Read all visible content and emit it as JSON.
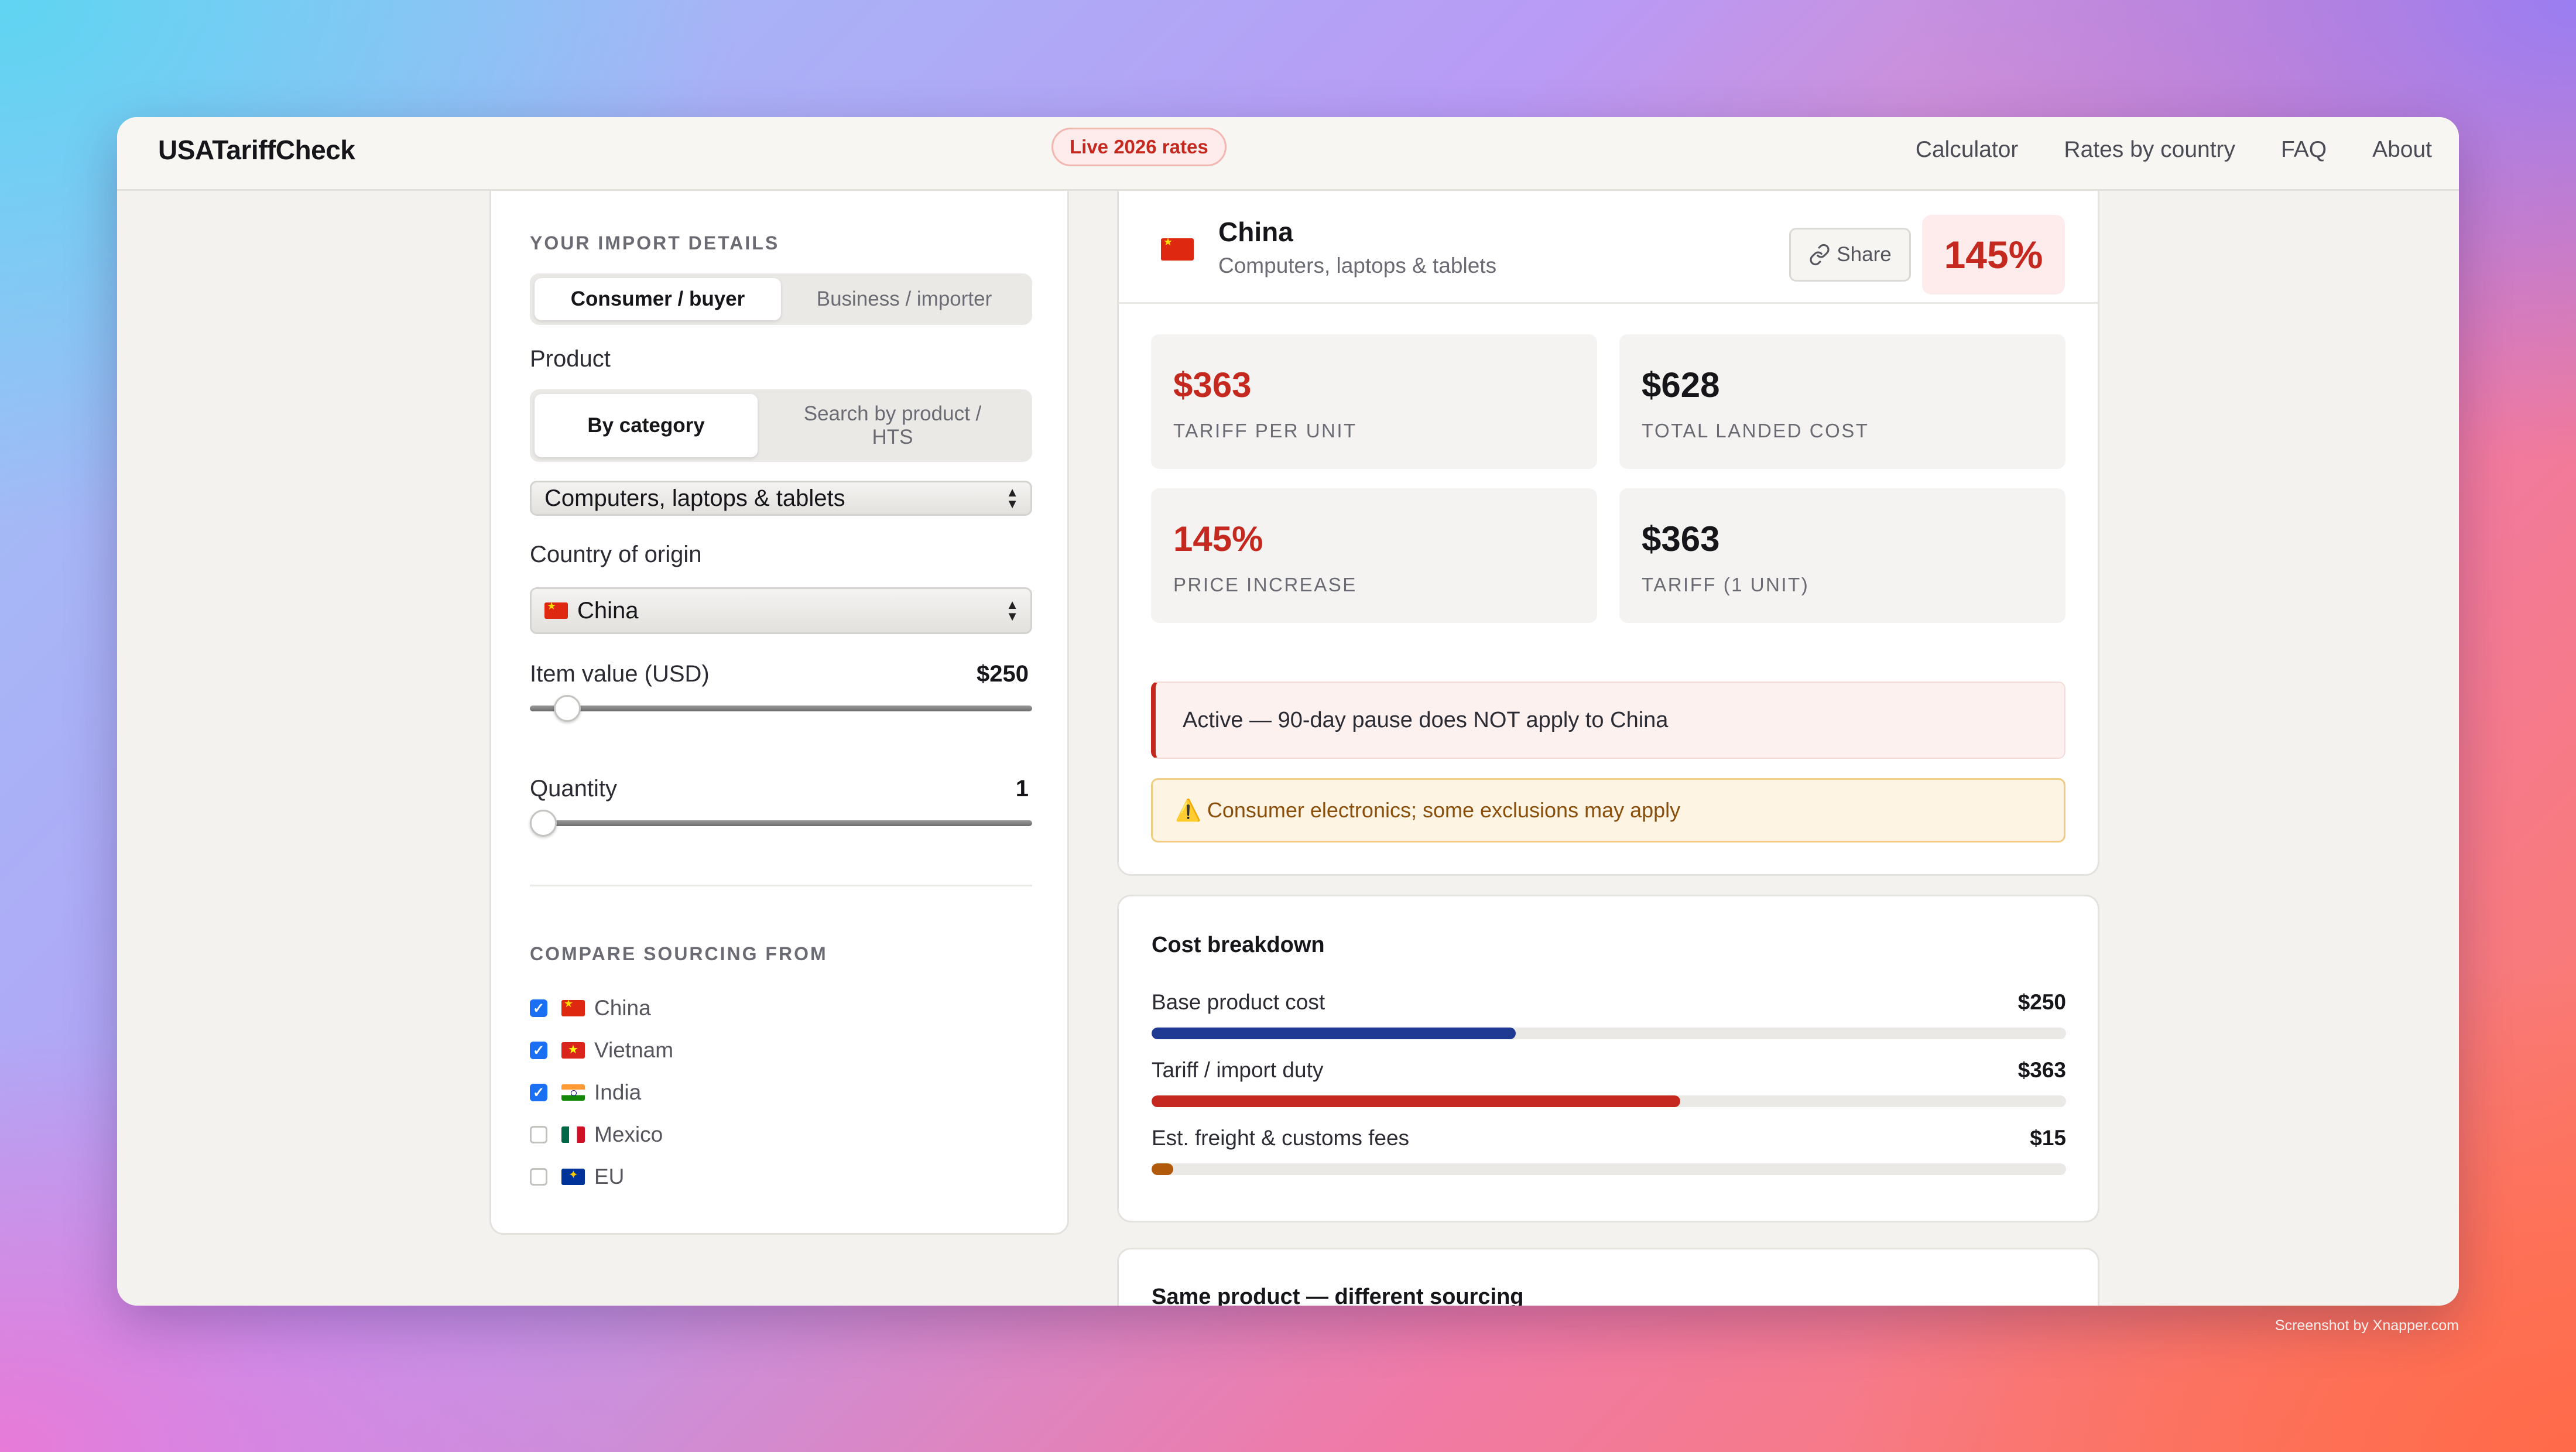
{
  "brand": "USATariffCheck",
  "badge": "Live 2026 rates",
  "nav": [
    "Calculator",
    "Rates by country",
    "FAQ",
    "About"
  ],
  "form": {
    "section_title": "YOUR IMPORT DETAILS",
    "mode_options": [
      "Consumer / buyer",
      "Business / importer"
    ],
    "mode_selected": "Consumer / buyer",
    "product_label": "Product",
    "product_mode_options": [
      "By category",
      "Search by product / HTS"
    ],
    "product_mode_selected": "By category",
    "category_value": "Computers, laptops & tablets",
    "country_label": "Country of origin",
    "country_value": "China",
    "item_value_label": "Item value (USD)",
    "item_value_display": "$250",
    "item_value_fraction": 0.05,
    "quantity_label": "Quantity",
    "quantity_display": "1",
    "quantity_fraction": 0.0,
    "compare_title": "COMPARE SOURCING FROM",
    "compare_options": [
      {
        "label": "China",
        "checked": true,
        "flag": "flag-cn"
      },
      {
        "label": "Vietnam",
        "checked": true,
        "flag": "flag-vn"
      },
      {
        "label": "India",
        "checked": true,
        "flag": "flag-in"
      },
      {
        "label": "Mexico",
        "checked": false,
        "flag": "flag-mx"
      },
      {
        "label": "EU",
        "checked": false,
        "flag": "flag-eu"
      }
    ]
  },
  "result": {
    "country": "China",
    "category": "Computers, laptops & tablets",
    "share_label": "Share",
    "share_icon": "link-icon",
    "rate": "145%",
    "stats": [
      {
        "value": "$363",
        "label": "TARIFF PER UNIT",
        "color": "red"
      },
      {
        "value": "$628",
        "label": "TOTAL LANDED COST",
        "color": "dark"
      },
      {
        "value": "145%",
        "label": "PRICE INCREASE",
        "color": "red"
      },
      {
        "value": "$363",
        "label": "TARIFF (1 UNIT)",
        "color": "dark"
      }
    ],
    "status_alert": "Active — 90-day pause does NOT apply to China",
    "warning_icon": "⚠️",
    "warning": "Consumer electronics; some exclusions may apply"
  },
  "cost_breakdown": {
    "title": "Cost breakdown",
    "rows": [
      {
        "label": "Base product cost",
        "amount": "$250",
        "fraction": 0.398,
        "color": "#1f3a93"
      },
      {
        "label": "Tariff / import duty",
        "amount": "$363",
        "fraction": 0.578,
        "color": "#c4281e"
      },
      {
        "label": "Est. freight & customs fees",
        "amount": "$15",
        "fraction": 0.024,
        "color": "#b25a0b"
      }
    ]
  },
  "sourcing_title": "Same product — different sourcing",
  "credit": "Screenshot by Xnapper.com",
  "colors": {
    "accent_red": "#c4281e",
    "base_bar": "#1f3a93",
    "freight_bar": "#b25a0b",
    "checkbox_blue": "#1a6ff2"
  }
}
